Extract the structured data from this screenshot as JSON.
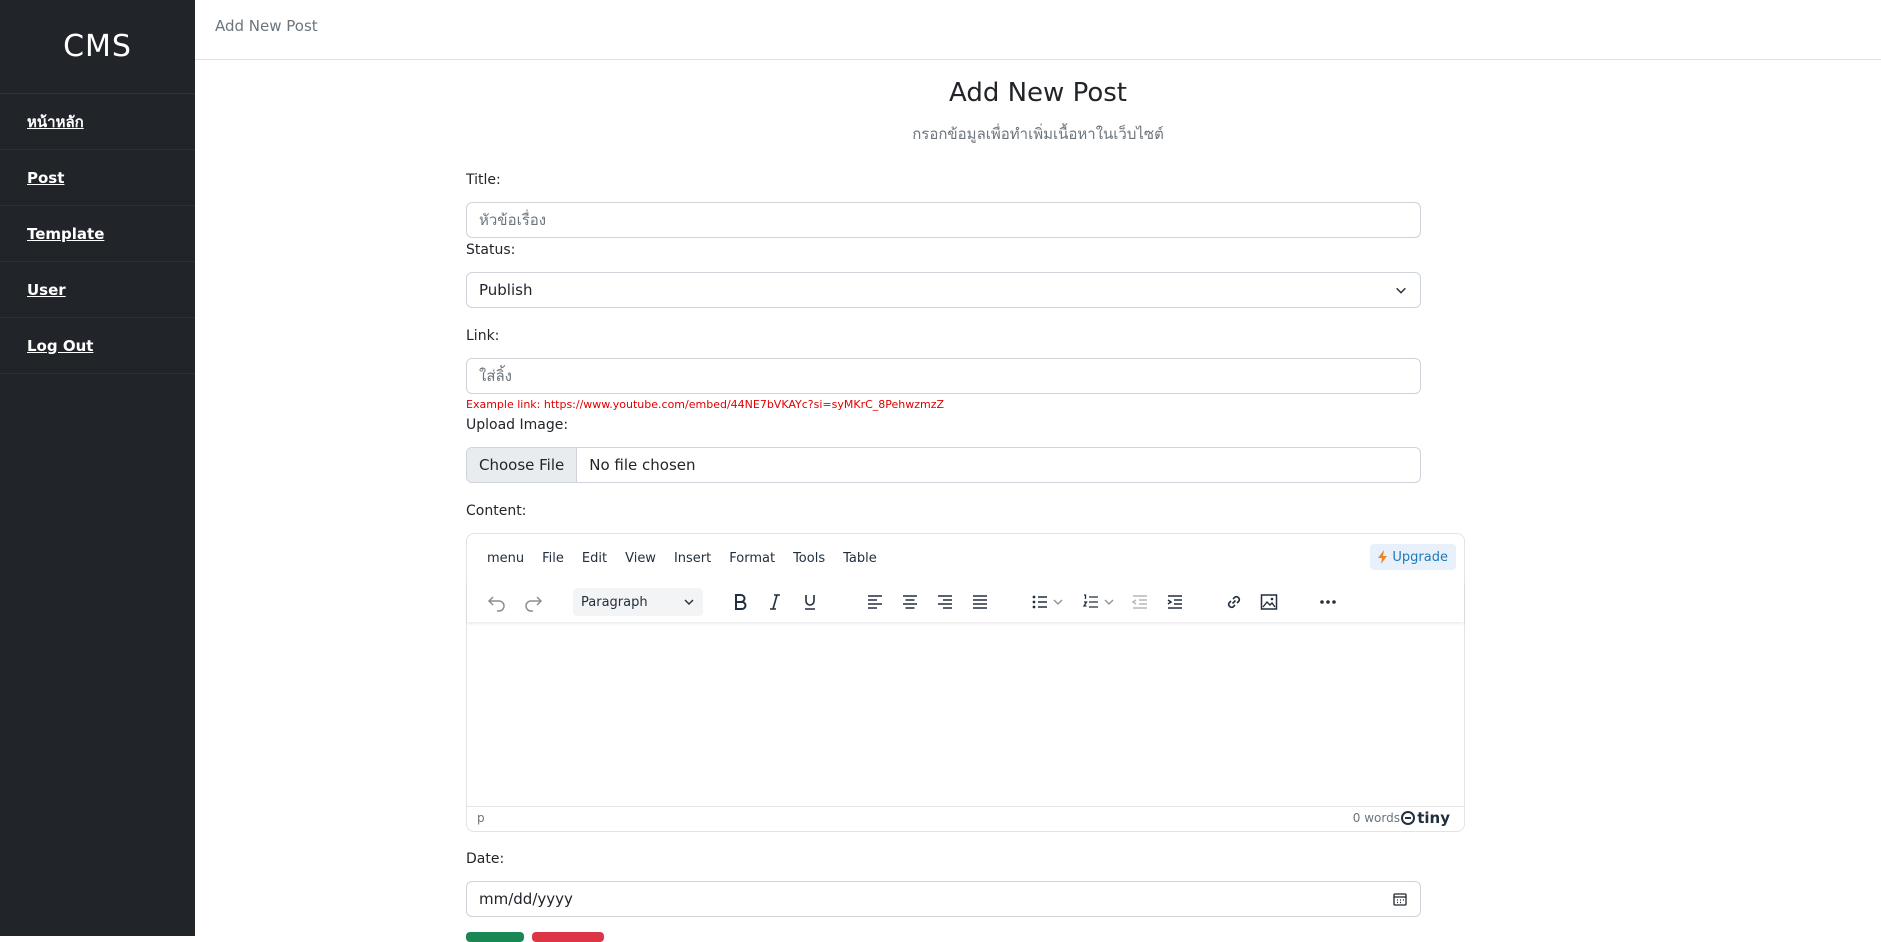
{
  "sidebar": {
    "brand": "CMS",
    "items": [
      {
        "label": "หน้าหลัก"
      },
      {
        "label": "Post"
      },
      {
        "label": "Template"
      },
      {
        "label": "User"
      },
      {
        "label": "Log Out"
      }
    ]
  },
  "topbar": {
    "breadcrumb": "Add New Post"
  },
  "header": {
    "title": "Add New Post",
    "subtitle": "กรอกข้อมูลเพื่อทำเพิ่มเนื้อหาในเว็บไซต์"
  },
  "form": {
    "title_label": "Title:",
    "title_placeholder": "หัวข้อเรื่อง",
    "status_label": "Status:",
    "status_value": "Publish",
    "link_label": "Link:",
    "link_placeholder": "ใส่ลิ้ง",
    "link_example": "Example link: https://www.youtube.com/embed/44NE7bVKAYc?si=syMKrC_8PehwzmzZ",
    "upload_label": "Upload Image:",
    "upload_button": "Choose File",
    "upload_status": "No file chosen",
    "content_label": "Content:",
    "date_label": "Date:",
    "date_placeholder": "mm/dd/yyyy"
  },
  "editor": {
    "menu": [
      "menu",
      "File",
      "Edit",
      "View",
      "Insert",
      "Format",
      "Tools",
      "Table"
    ],
    "upgrade": "Upgrade",
    "block_format": "Paragraph",
    "path": "p",
    "word_count": "0 words",
    "brand": "tiny"
  },
  "colors": {
    "sidebar_bg": "#212529",
    "example_text": "#e00000",
    "upgrade_icon": "#f5821f"
  }
}
